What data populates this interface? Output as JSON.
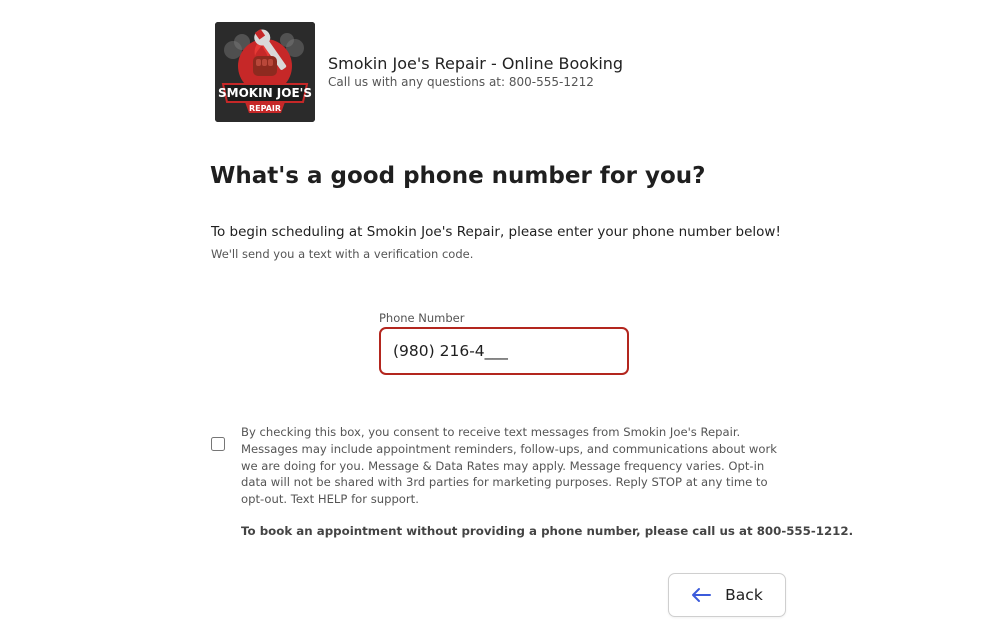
{
  "header": {
    "logo_text_line1": "SMOKIN JOE'S",
    "logo_text_line2": "REPAIR",
    "business_name": "Smokin Joe's Repair - Online Booking",
    "contact_line": "Call us with any questions at: 800-555-1212"
  },
  "main": {
    "heading": "What's a good phone number for you?",
    "intro": "To begin scheduling at Smokin Joe's Repair, please enter your phone number below!",
    "intro_sub": "We'll send you a text with a verification code.",
    "phone_field": {
      "label": "Phone Number",
      "value": "(980) 216-4___"
    },
    "consent": {
      "checked": false,
      "text": "By checking this box, you consent to receive text messages from Smokin Joe's Repair. Messages may include appointment reminders, follow-ups, and communications about work we are doing for you. Message & Data Rates may apply. Message frequency varies. Opt-in data will not be shared with 3rd parties for marketing purposes. Reply STOP at any time to opt-out. Text HELP for support."
    },
    "call_note": "To book an appointment without providing a phone number, please call us at 800-555-1212."
  },
  "footer": {
    "back_label": "Back"
  },
  "colors": {
    "input_border_error": "#b3261e",
    "arrow_accent": "#3b5bdb",
    "logo_red": "#c62828"
  },
  "icons": {
    "back": "arrow-left-icon",
    "logo": "fist-wrench-icon"
  }
}
